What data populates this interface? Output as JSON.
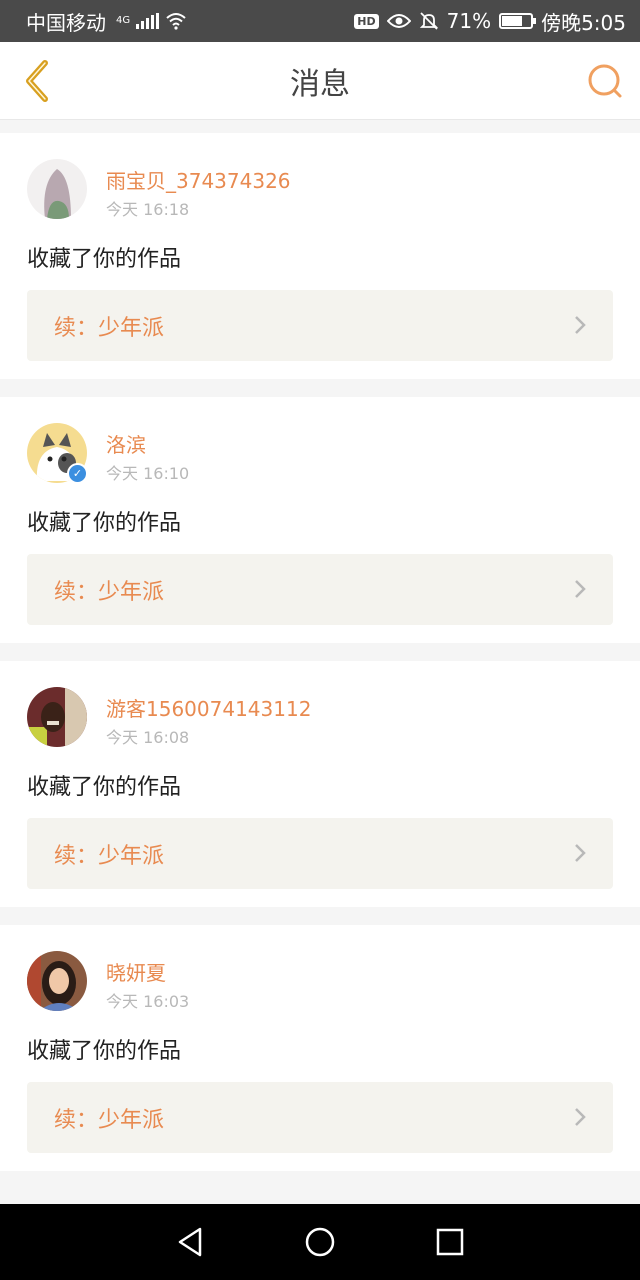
{
  "status_bar": {
    "carrier": "中国移动",
    "network": "4G",
    "battery_percent": "71%",
    "battery_level": 0.71,
    "time": "傍晚5:05"
  },
  "header": {
    "title": "消息"
  },
  "messages": [
    {
      "username": "雨宝贝_374374326",
      "time": "今天 16:18",
      "action": "收藏了你的作品",
      "work_title": "续：少年派",
      "verified": false
    },
    {
      "username": "洛滨",
      "time": "今天 16:10",
      "action": "收藏了你的作品",
      "work_title": "续：少年派",
      "verified": true
    },
    {
      "username": "游客1560074143112",
      "time": "今天 16:08",
      "action": "收藏了你的作品",
      "work_title": "续：少年派",
      "verified": false
    },
    {
      "username": "晓妍夏",
      "time": "今天 16:03",
      "action": "收藏了你的作品",
      "work_title": "续：少年派",
      "verified": false
    }
  ],
  "colors": {
    "accent": "#e88a50",
    "back_icon": "#d8a020",
    "work_bg": "#f4f3ee",
    "status_bar_bg": "#4a4a4a"
  },
  "icons": [
    "back-arrow-icon",
    "search-icon",
    "chevron-right-icon",
    "verified-icon",
    "nav-back-icon",
    "nav-home-icon",
    "nav-recents-icon",
    "wifi-icon",
    "eye-icon",
    "mute-bell-icon",
    "battery-icon",
    "signal-icon"
  ]
}
